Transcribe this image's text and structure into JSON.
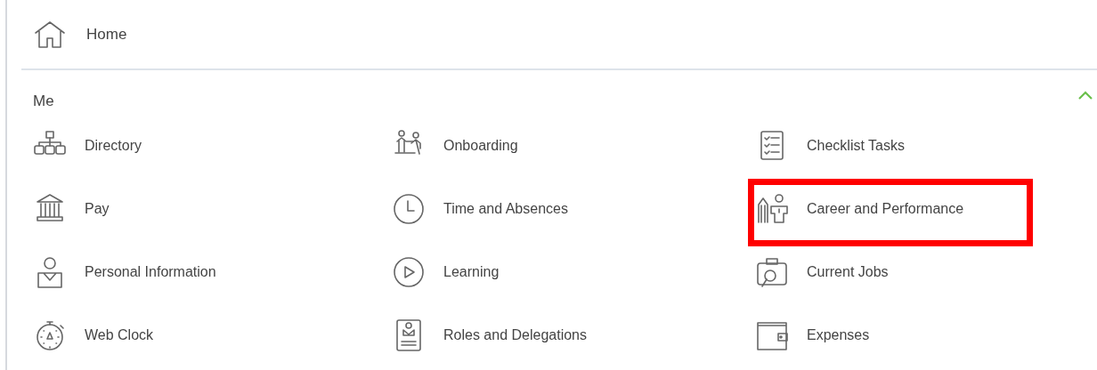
{
  "home": {
    "label": "Home"
  },
  "section": {
    "title": "Me",
    "expanded": true,
    "items": [
      {
        "label": "Directory",
        "highlighted": false
      },
      {
        "label": "Onboarding",
        "highlighted": false
      },
      {
        "label": "Checklist Tasks",
        "highlighted": false
      },
      {
        "label": "Pay",
        "highlighted": false
      },
      {
        "label": "Time and Absences",
        "highlighted": false
      },
      {
        "label": "Career and Performance",
        "highlighted": true
      },
      {
        "label": "Personal Information",
        "highlighted": false
      },
      {
        "label": "Learning",
        "highlighted": false
      },
      {
        "label": "Current Jobs",
        "highlighted": false
      },
      {
        "label": "Web Clock",
        "highlighted": false
      },
      {
        "label": "Roles and Delegations",
        "highlighted": false
      },
      {
        "label": "Expenses",
        "highlighted": false
      }
    ]
  }
}
